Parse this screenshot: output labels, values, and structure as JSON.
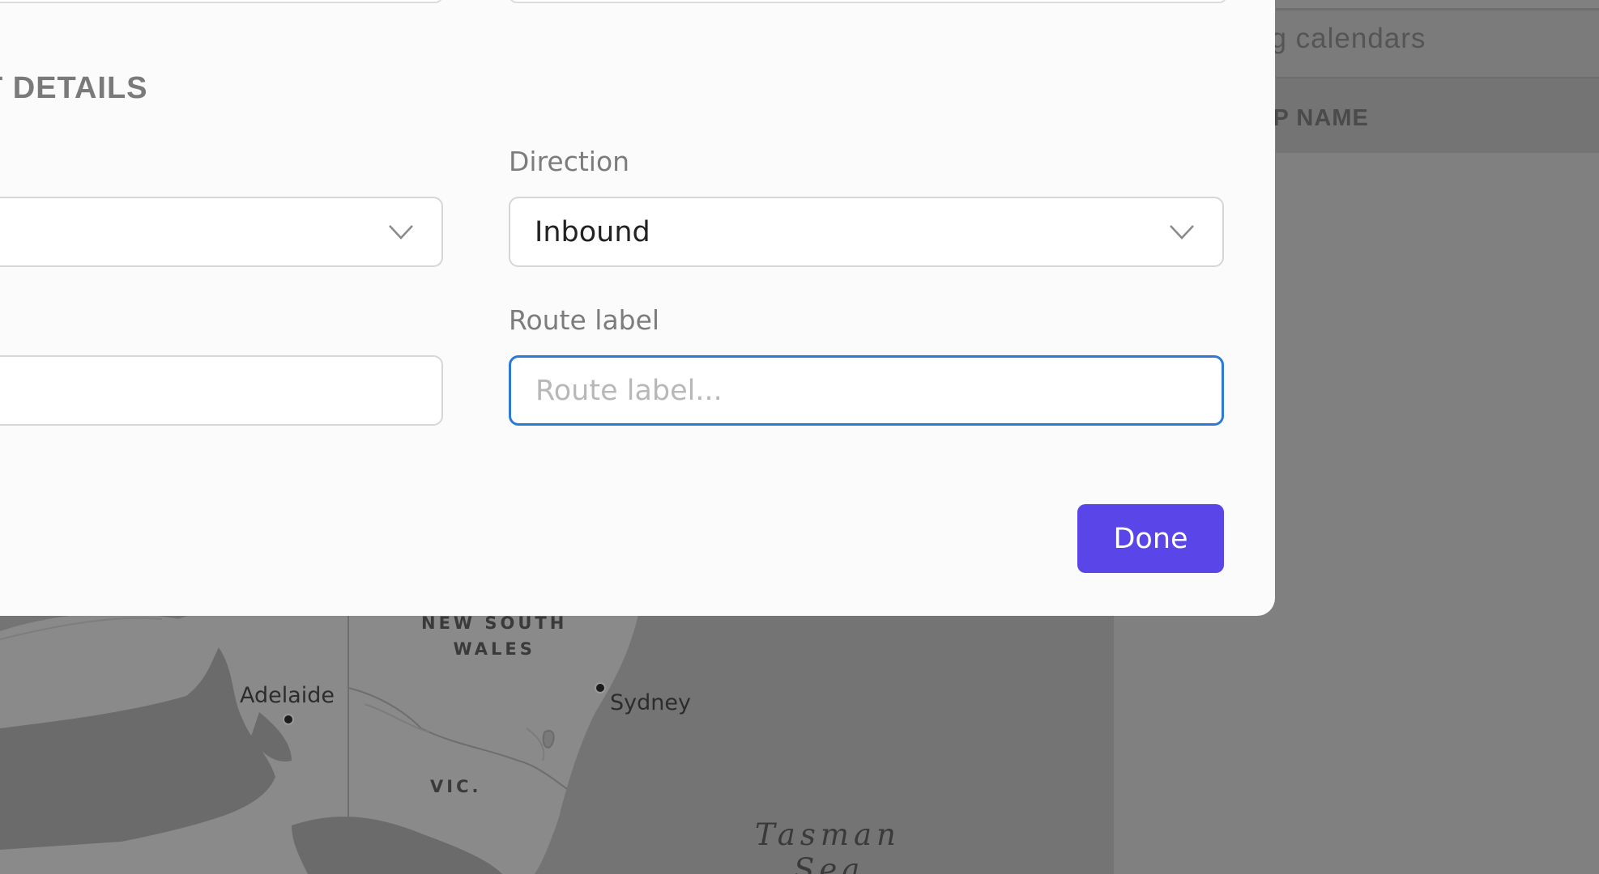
{
  "map": {
    "labels": {
      "region_nsw_line1": "NEW SOUTH",
      "region_nsw_line2": "WALES",
      "region_vic": "VIC.",
      "city_adelaide": "Adelaide",
      "city_sydney": "Sydney",
      "sea_tasman_line1": "Tasman",
      "sea_tasman_line2": "Sea"
    }
  },
  "right_panel": {
    "search_text": "ng calendars",
    "column_header": "OP NAME"
  },
  "modal": {
    "section_title": "T DETAILS",
    "direction": {
      "label": "Direction",
      "value": "Inbound"
    },
    "route_label": {
      "label": "Route label",
      "placeholder": "Route label...",
      "value": ""
    },
    "done_label": "Done"
  },
  "colors": {
    "accent": "#5a46e8",
    "focus_border": "#2b7bd6"
  },
  "icons": {
    "select_chevron": "chevron-down-icon"
  }
}
